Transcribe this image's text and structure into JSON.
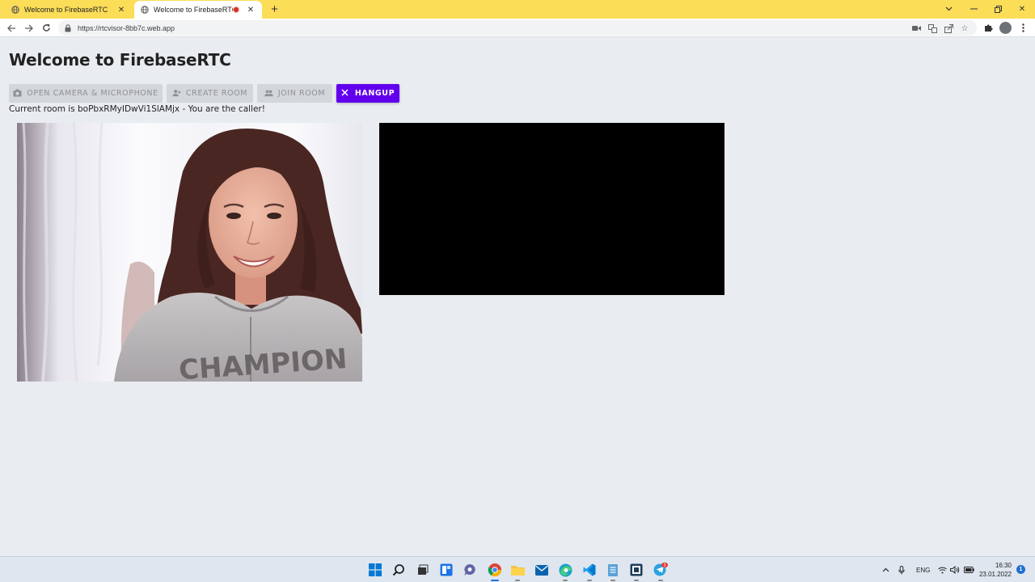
{
  "browser": {
    "tabs": [
      {
        "title": "Welcome to FirebaseRTC",
        "active": false
      },
      {
        "title": "Welcome to FirebaseRTC",
        "active": true,
        "recording": true
      }
    ],
    "new_tab_label": "+",
    "url": "https://rtcvisor-8bb7c.web.app"
  },
  "page": {
    "title": "Welcome to FirebaseRTC",
    "buttons": {
      "open_camera": "OPEN CAMERA & MICROPHONE",
      "create_room": "CREATE ROOM",
      "join_room": "JOIN ROOM",
      "hangup": "HANGUP"
    },
    "room_status": "Current room is boPbxRMyIDwVi1SlAMjx - You are the caller!",
    "local_video_text": "CHAMPION"
  },
  "colors": {
    "tab_strip": "#fbdd58",
    "primary_button": "#6200ee",
    "page_background": "#e9ecf0"
  },
  "taskbar": {
    "tray_language": "ENG",
    "clock_time": "16:30",
    "clock_date": "23.01.2022",
    "notification_count": "1",
    "telegram_badge": "3"
  }
}
